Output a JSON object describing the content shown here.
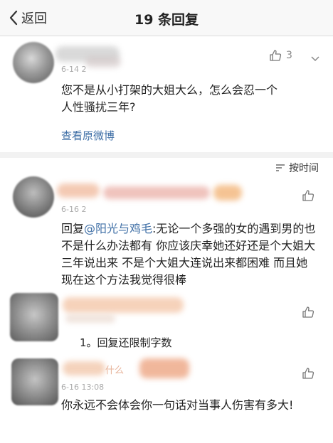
{
  "header": {
    "back_label": "返回",
    "title": "19 条回复"
  },
  "original": {
    "time": "6-14 2",
    "likes": "3",
    "text": "您不是从小打架的大姐大么，怎么会忍一个人性骚扰三年?",
    "view_original": "查看原微博"
  },
  "sort_label": "按时间",
  "replies": [
    {
      "time": "6-16 2",
      "reply_prefix": "回复",
      "mention": "@阳光与鸡毛",
      "text": ":无论一个多强的女的遇到男的也不是什么办法都有 你应该庆幸她还好还是个大姐大三年说出来 不是个大姐大连说出来都困难 而且她现在这个方法我觉得很棒"
    },
    {
      "time": "",
      "text": "1。回复还限制字数"
    },
    {
      "name_fragment": "什么",
      "time": "6-16 13:08",
      "text": "你永远不会体会你一句话对当事人伤害有多大!"
    }
  ],
  "colors": {
    "link": "#3f6fa6",
    "muted": "#aaaaaa"
  }
}
